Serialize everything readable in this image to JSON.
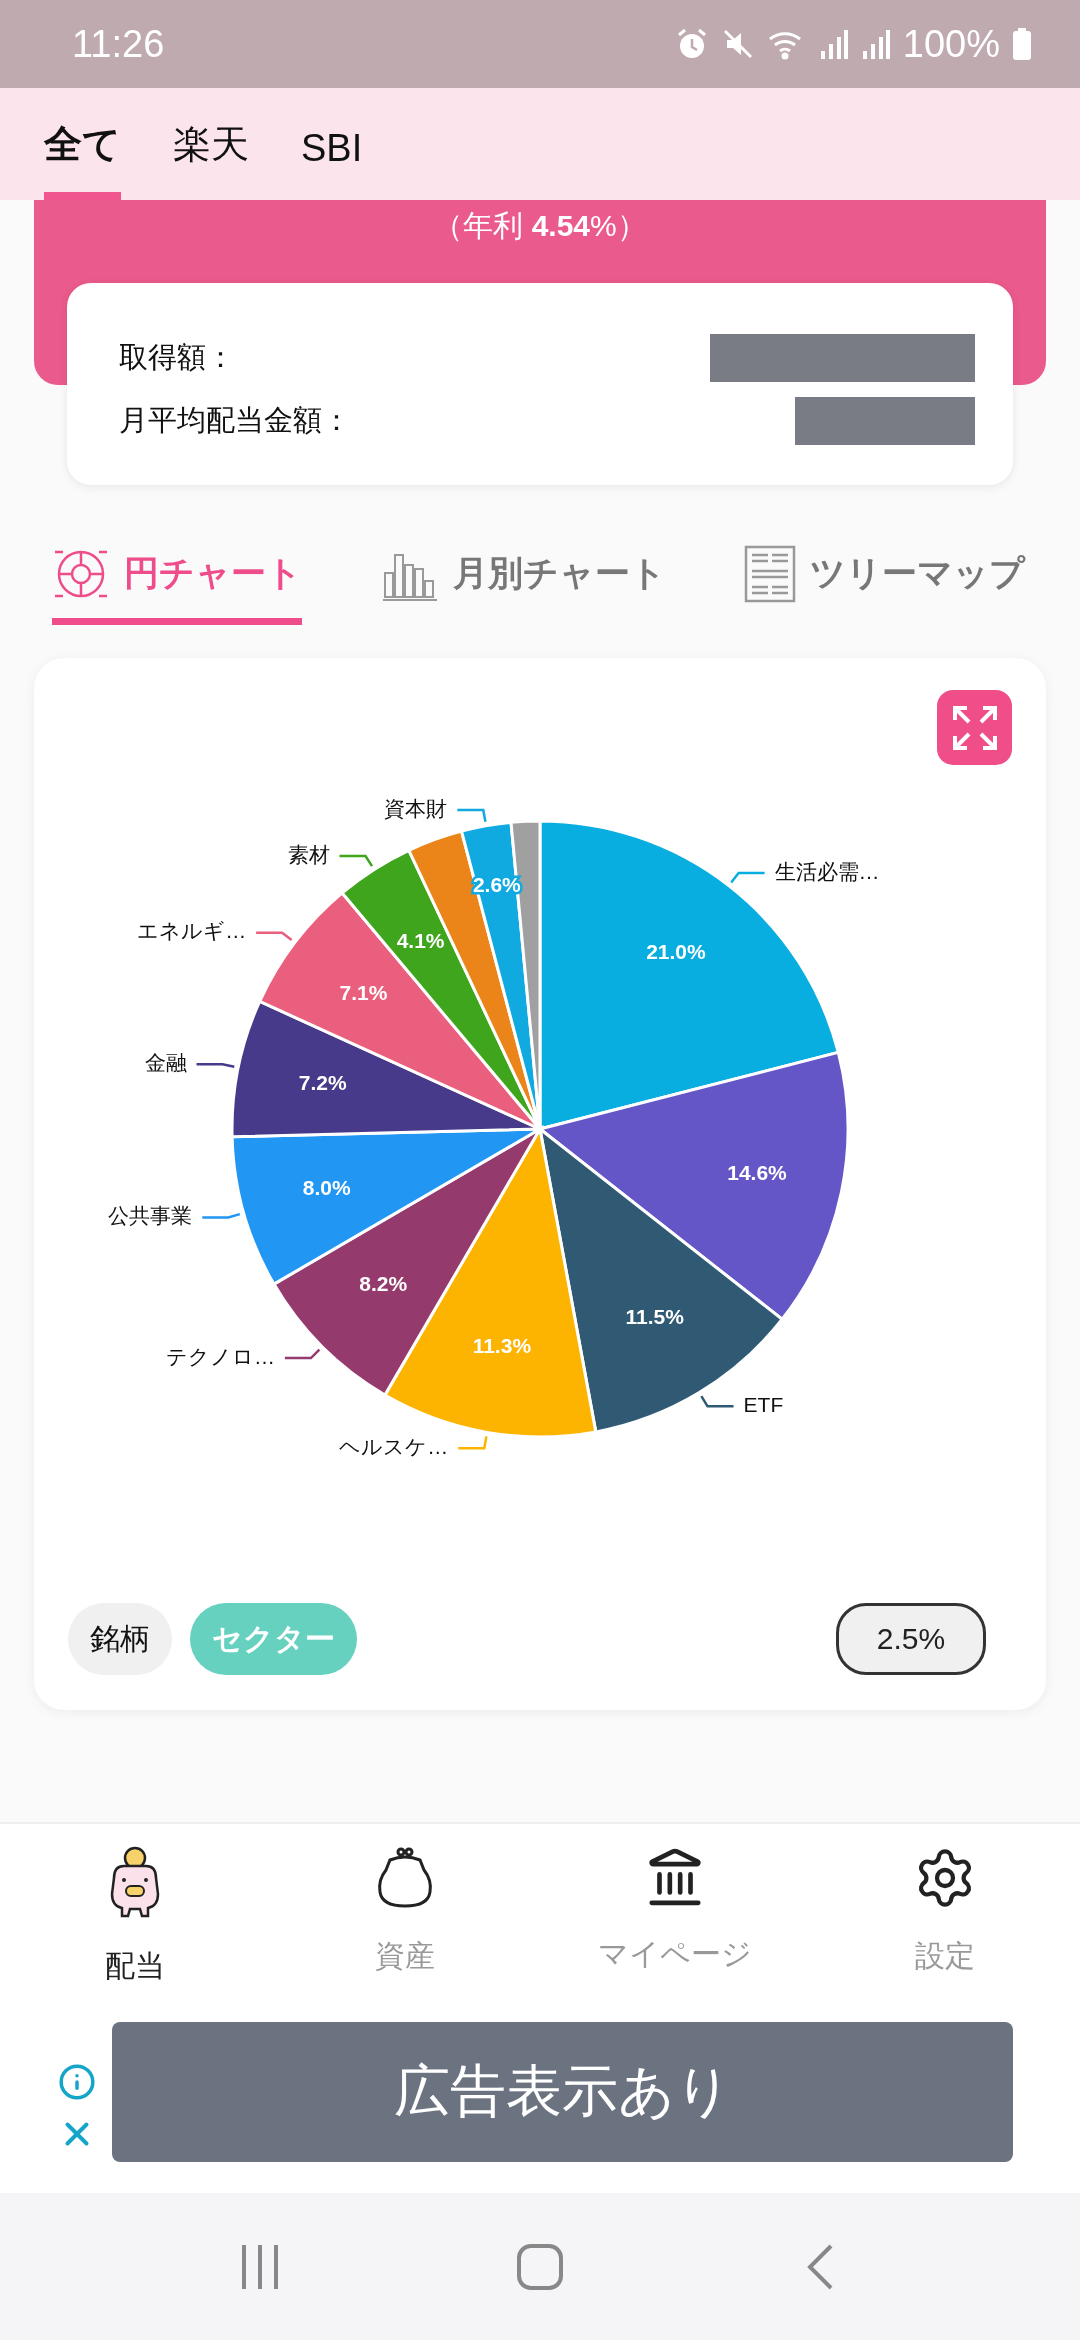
{
  "status_bar": {
    "time": "11:26",
    "battery": "100%"
  },
  "account_tabs": [
    {
      "label": "全て",
      "selected": true
    },
    {
      "label": "楽天",
      "selected": false
    },
    {
      "label": "SBI",
      "selected": false
    }
  ],
  "summary": {
    "yield": "（年利 **4.54**%）",
    "rows": [
      {
        "label": "取得額："
      },
      {
        "label": "月平均配当金額："
      }
    ]
  },
  "chart_tabs": [
    {
      "label": "円チャート",
      "selected": true,
      "kind": "pie"
    },
    {
      "label": "月別チャート",
      "selected": false,
      "kind": "monthly"
    },
    {
      "label": "ツリーマップ",
      "selected": false,
      "kind": "treemap"
    }
  ],
  "chart_data": {
    "type": "pie",
    "categories": [
      "生活必需…",
      null,
      "ETF",
      "ヘルスケ…",
      "テクノロ…",
      "公共事業",
      "金融",
      "エネルギ…",
      "素材",
      null,
      "資本財",
      null
    ],
    "values": [
      21.0,
      14.6,
      11.5,
      11.3,
      8.2,
      8.0,
      7.2,
      7.1,
      4.1,
      2.9,
      2.6,
      1.5
    ],
    "value_labels": [
      "21.0%",
      "14.6%",
      "11.5%",
      "11.3%",
      "8.2%",
      "8.0%",
      "7.2%",
      "7.1%",
      "4.1%",
      null,
      "2.6%",
      null
    ],
    "colors": [
      "#08aedf",
      "#6456c6",
      "#305a74",
      "#fcb400",
      "#953a6c",
      "#2196f3",
      "#473a8a",
      "#ea5f7d",
      "#3ea51d",
      "#ec8519",
      "#10a9e0",
      "#a0a0a0"
    ]
  },
  "group_toggle": [
    {
      "label": "銘柄",
      "selected": false
    },
    {
      "label": "セクター",
      "selected": true
    }
  ],
  "threshold": "2.5%",
  "bottom_nav": [
    {
      "label": "配当",
      "selected": true,
      "kind": "piggy"
    },
    {
      "label": "資産",
      "selected": false,
      "kind": "purse"
    },
    {
      "label": "マイページ",
      "selected": false,
      "kind": "bank"
    },
    {
      "label": "設定",
      "selected": false,
      "kind": "gear"
    }
  ],
  "ad": {
    "text": "広告表示あり"
  }
}
